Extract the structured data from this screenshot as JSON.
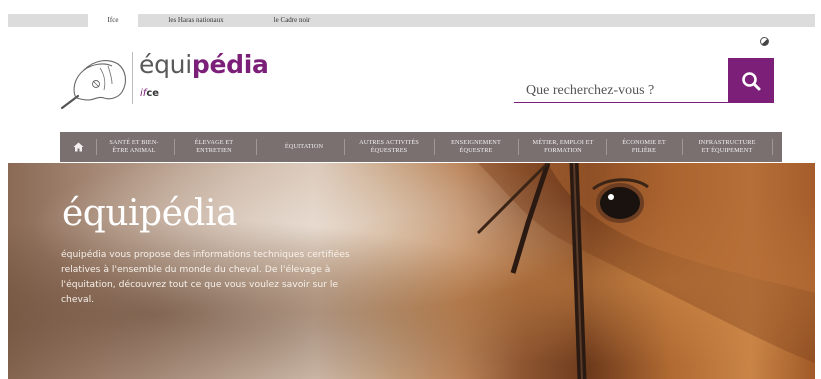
{
  "topbar": {
    "tabs": [
      {
        "label": "Ifce",
        "active": true
      },
      {
        "label": "les Haras nationaux",
        "active": false
      },
      {
        "label": "le Cadre noir",
        "active": false
      }
    ]
  },
  "header": {
    "logo": {
      "name_light": "équi",
      "name_bold": "pédia",
      "sub_italic": "if",
      "sub_bold": "ce"
    },
    "contrast_icon": "contrast-icon",
    "search": {
      "placeholder": "Que recherchez-vous ?",
      "button_icon": "search-icon"
    }
  },
  "nav": {
    "home_icon": "home-icon",
    "items": [
      {
        "line1": "Santé et bien-",
        "line2": "être animal"
      },
      {
        "line1": "Élevage et",
        "line2": "entretien"
      },
      {
        "line1": "Équitation",
        "line2": ""
      },
      {
        "line1": "Autres activités",
        "line2": "équestres"
      },
      {
        "line1": "Enseignement",
        "line2": "équestre"
      },
      {
        "line1": "Métier, emploi et",
        "line2": "formation"
      },
      {
        "line1": "Économie et",
        "line2": "filière"
      },
      {
        "line1": "Infrastructure",
        "line2": "et équipement"
      }
    ]
  },
  "hero": {
    "title": "équipédia",
    "text": "équipédia vous propose des informations techniques certifiées relatives à l'ensemble du monde du cheval. De l'élevage à l'équitation, découvrez tout ce que vous voulez savoir sur le cheval."
  },
  "colors": {
    "brand": "#7b1f78",
    "nav_bg": "#7a7070",
    "topbar_bg": "#dcdcdc"
  }
}
